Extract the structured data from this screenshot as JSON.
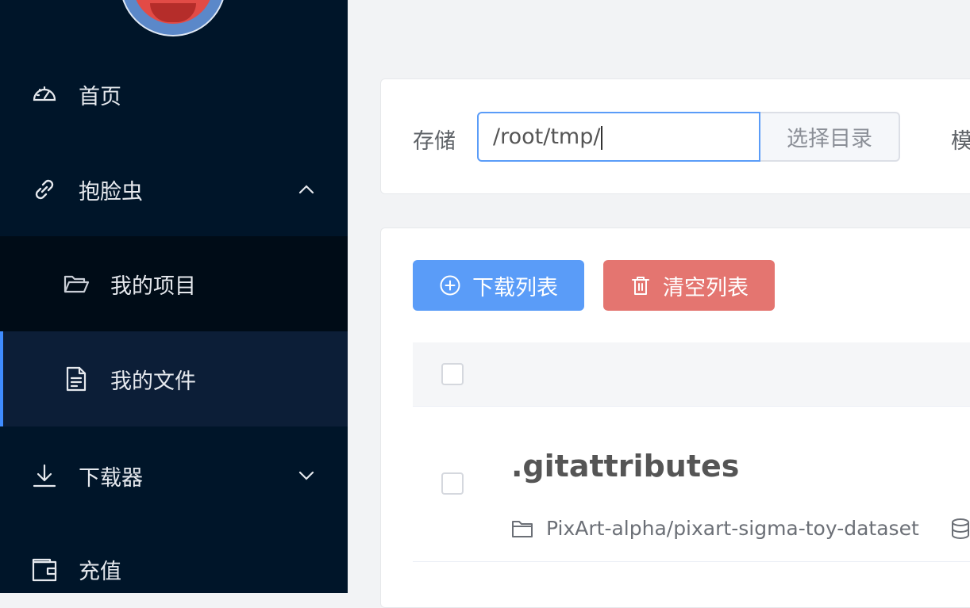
{
  "sidebar": {
    "items": [
      {
        "label": "首页",
        "icon": "dashboard-icon"
      },
      {
        "label": "抱脸虫",
        "icon": "link-icon",
        "expanded": true
      },
      {
        "label": "我的项目",
        "icon": "folder-open-icon"
      },
      {
        "label": "我的文件",
        "icon": "document-icon",
        "active": true
      },
      {
        "label": "下载器",
        "icon": "download-icon",
        "expanded": false
      },
      {
        "label": "充值",
        "icon": "wallet-icon"
      }
    ]
  },
  "storage": {
    "label": "存储",
    "path_value": "/root/tmp/",
    "choose_label": "选择目录",
    "next_label_partial": "模"
  },
  "toolbar": {
    "download_label": "下载列表",
    "clear_label": "清空列表"
  },
  "files": [
    {
      "name": ".gitattributes",
      "repo": "PixArt-alpha/pixart-sigma-toy-dataset"
    }
  ],
  "colors": {
    "sidebar_bg": "#001529",
    "accent": "#5a9cf8",
    "danger": "#e47570"
  }
}
